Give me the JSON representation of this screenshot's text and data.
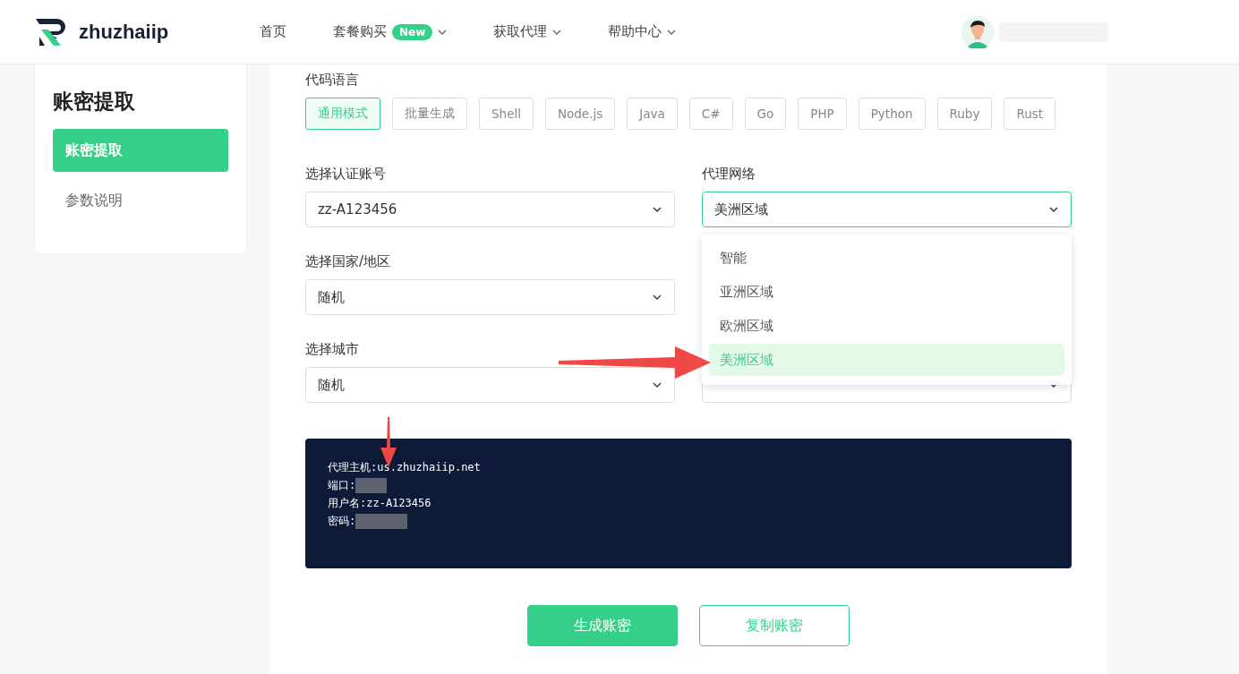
{
  "header": {
    "logo": {
      "text": "zhuzhaiip"
    },
    "nav": [
      {
        "label": "首页",
        "dropdown": false
      },
      {
        "label": "套餐购买",
        "badge": "New",
        "dropdown": true
      },
      {
        "label": "获取代理",
        "dropdown": true
      },
      {
        "label": "帮助中心",
        "dropdown": true
      }
    ],
    "user": {
      "name_hidden": true
    }
  },
  "sidebar": {
    "title": "账密提取",
    "items": [
      {
        "label": "账密提取",
        "selected": true
      },
      {
        "label": "参数说明",
        "selected": false
      }
    ]
  },
  "code_language": {
    "label": "代码语言",
    "options": [
      {
        "label": "通用模式",
        "selected": true
      },
      {
        "label": "批量生成",
        "selected": false
      },
      {
        "label": "Shell",
        "selected": false
      },
      {
        "label": "Node.js",
        "selected": false
      },
      {
        "label": "Java",
        "selected": false
      },
      {
        "label": "C#",
        "selected": false
      },
      {
        "label": "Go",
        "selected": false
      },
      {
        "label": "PHP",
        "selected": false
      },
      {
        "label": "Python",
        "selected": false
      },
      {
        "label": "Ruby",
        "selected": false
      },
      {
        "label": "Rust",
        "selected": false
      }
    ]
  },
  "form": {
    "rows": [
      {
        "left": {
          "label": "选择认证账号",
          "value": "zz-A123456",
          "focused": false
        },
        "right": {
          "label": "代理网络",
          "value": "美洲区域",
          "focused": true,
          "dropdown": {
            "options": [
              {
                "label": "智能",
                "selected": false
              },
              {
                "label": "亚洲区域",
                "selected": false
              },
              {
                "label": "欧洲区域",
                "selected": false
              },
              {
                "label": "美洲区域",
                "selected": true
              }
            ]
          }
        }
      },
      {
        "left": {
          "label": "选择国家/地区",
          "value": "随机",
          "focused": false
        }
      },
      {
        "left": {
          "label": "选择城市",
          "value": "随机",
          "focused": false
        },
        "right": {
          "focused": false
        }
      }
    ]
  },
  "output": {
    "lines": [
      {
        "text": "代理主机:us.zhuzhaiip.net",
        "redacted": false
      },
      {
        "text": "端口:",
        "redacted": true
      },
      {
        "text": "用户名:zz-A123456",
        "redacted": false
      },
      {
        "text": "密码:",
        "redacted": true
      }
    ]
  },
  "buttons": [
    {
      "label": "生成账密",
      "kind": "primary"
    },
    {
      "label": "复制账密",
      "kind": "outline"
    }
  ],
  "annotations": [
    {
      "kind": "right-arrow"
    },
    {
      "kind": "down-arrow"
    }
  ]
}
